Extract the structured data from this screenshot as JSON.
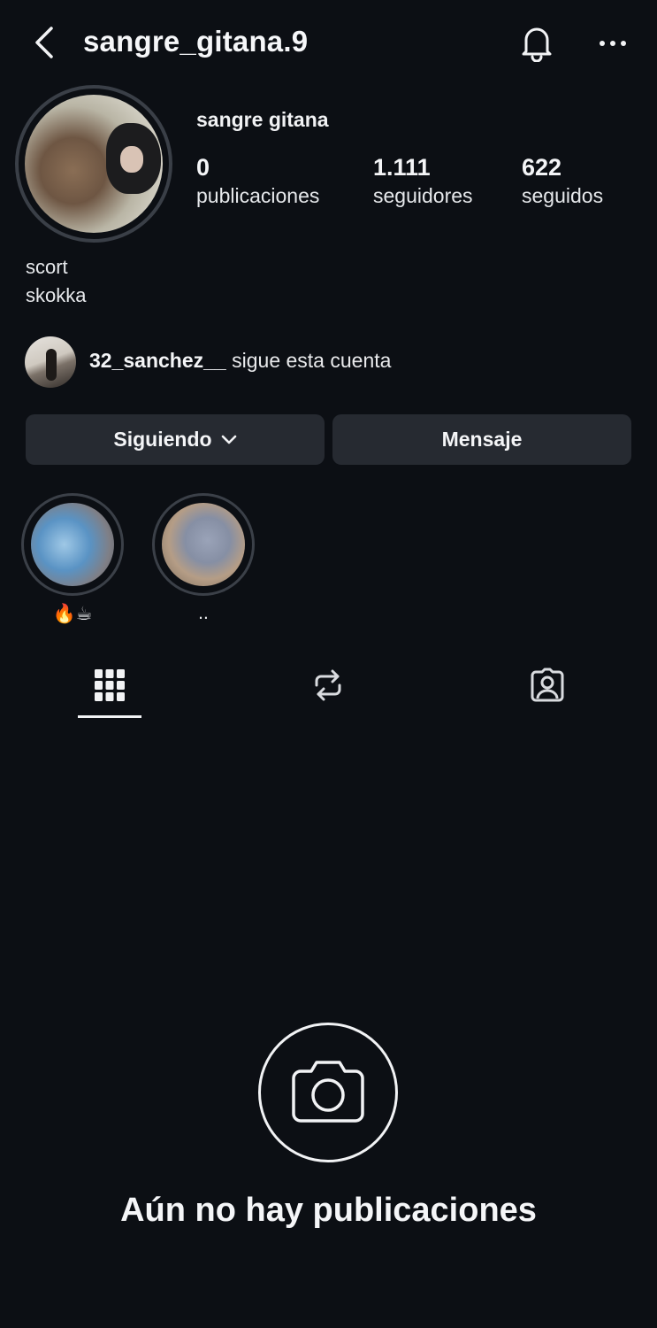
{
  "header": {
    "username": "sangre_gitana.9",
    "back_icon": "chevron-left-icon",
    "bell_icon": "bell-icon",
    "more_icon": "more-horizontal-icon"
  },
  "profile": {
    "display_name": "sangre gitana",
    "stats": {
      "posts": {
        "value": "0",
        "label": "publicaciones"
      },
      "followers": {
        "value": "1.111",
        "label": "seguidores"
      },
      "following": {
        "value": "622",
        "label": "seguidos"
      }
    },
    "bio_lines": [
      "scort",
      "skokka"
    ]
  },
  "mutual": {
    "username": "32_sanchez__",
    "text": " sigue esta cuenta"
  },
  "actions": {
    "following_label": "Siguiendo",
    "message_label": "Mensaje"
  },
  "highlights": [
    {
      "label": "🔥☕"
    },
    {
      "label": ".."
    }
  ],
  "tabs": {
    "active": "grid",
    "icons": [
      "grid-icon",
      "repost-icon",
      "tagged-icon"
    ]
  },
  "empty_state": {
    "icon": "camera-icon",
    "message": "Aún no hay publicaciones"
  },
  "colors": {
    "background": "#0c0f14",
    "button": "#262a31",
    "text": "#f2f3f5"
  }
}
